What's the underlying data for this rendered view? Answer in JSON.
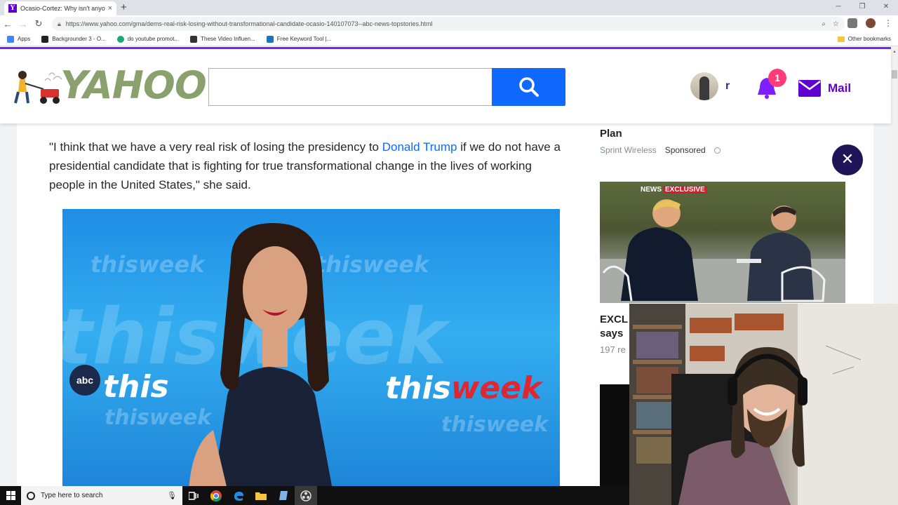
{
  "browser": {
    "tab_title": "Ocasio-Cortez: Why isn't anyone",
    "favicon": "Y",
    "tab_close": "×",
    "new_tab": "+",
    "url": "https://www.yahoo.com/gma/dems-real-risk-losing-without-transformational-candidate-ocasio-140107073--abc-news-topstories.html",
    "bookmarks": [
      {
        "label": "Apps",
        "color": "#4285f4"
      },
      {
        "label": "Backgrounder 3 - O...",
        "color": "#222222"
      },
      {
        "label": "do youtube promot...",
        "color": "#19a974"
      },
      {
        "label": "These Video Influen...",
        "color": "#333333"
      },
      {
        "label": "Free Keyword Tool |...",
        "color": "#1e73be"
      }
    ],
    "other_bookmarks": "Other bookmarks"
  },
  "header": {
    "logo": "YAHOO!",
    "search_placeholder": "",
    "user_name": "r",
    "notification_count": "1",
    "mail_label": "Mail",
    "accent": "#5f01d1",
    "search_color": "#0f69ff"
  },
  "article": {
    "para_before": "\"I think that we have a very real risk of losing the presidency to ",
    "link": "Donald Trump",
    "para_after": " if we do not have a presidential candidate that is fighting for true transformational change in the lives of working people in the United States,\" she said.",
    "photo_wordmark": "thisweek",
    "photo_wm_this": "this",
    "photo_wm_week": "week",
    "photo_abc": "abc"
  },
  "sidebar": {
    "ad_title_prev": "...",
    "ad_title": "Plan",
    "sponsor_name": "Sprint Wireless",
    "sponsored_label": "Sponsored",
    "close": "✕",
    "news_tag_network": "NEWS",
    "news_tag_label": "EXCLUSIVE",
    "headline_line1": "EXCL",
    "headline_line2": "says",
    "meta": "197 re"
  },
  "taskbar": {
    "search_placeholder": "Type here to search"
  }
}
